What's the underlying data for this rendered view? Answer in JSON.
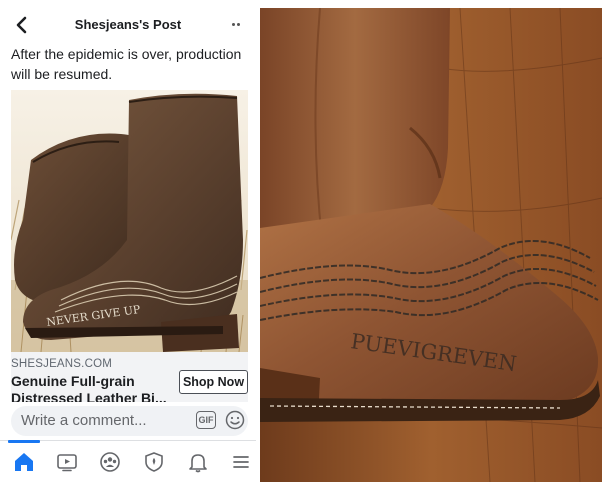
{
  "header": {
    "title": "Shesjeans's Post",
    "back_icon": "chevron-left-icon",
    "more_icon": "more-dots-icon"
  },
  "post": {
    "text": "After the epidemic is over, production will be resumed."
  },
  "ad_image": {
    "boot_text": "NEVER GIVE UP"
  },
  "ad": {
    "domain": "SHESJEANS.COM",
    "title": "Genuine Full-grain Distressed Leather Bi...",
    "cta_label": "Shop Now"
  },
  "comment": {
    "placeholder": "Write a comment...",
    "gif_label": "GIF",
    "emoji_icon": "smiley-icon"
  },
  "tabs": [
    {
      "name": "home",
      "icon": "home-icon",
      "active": true
    },
    {
      "name": "watch",
      "icon": "video-icon",
      "active": false
    },
    {
      "name": "groups",
      "icon": "groups-icon",
      "active": false
    },
    {
      "name": "shield",
      "icon": "shield-icon",
      "active": false
    },
    {
      "name": "notifications",
      "icon": "bell-icon",
      "active": false
    },
    {
      "name": "menu",
      "icon": "menu-icon",
      "active": false
    }
  ],
  "photo": {
    "boot_text": "PUEVIGREVEN"
  },
  "colors": {
    "accent": "#1877f2",
    "leather": "#8a5230",
    "wood": "#9a5a2c"
  }
}
